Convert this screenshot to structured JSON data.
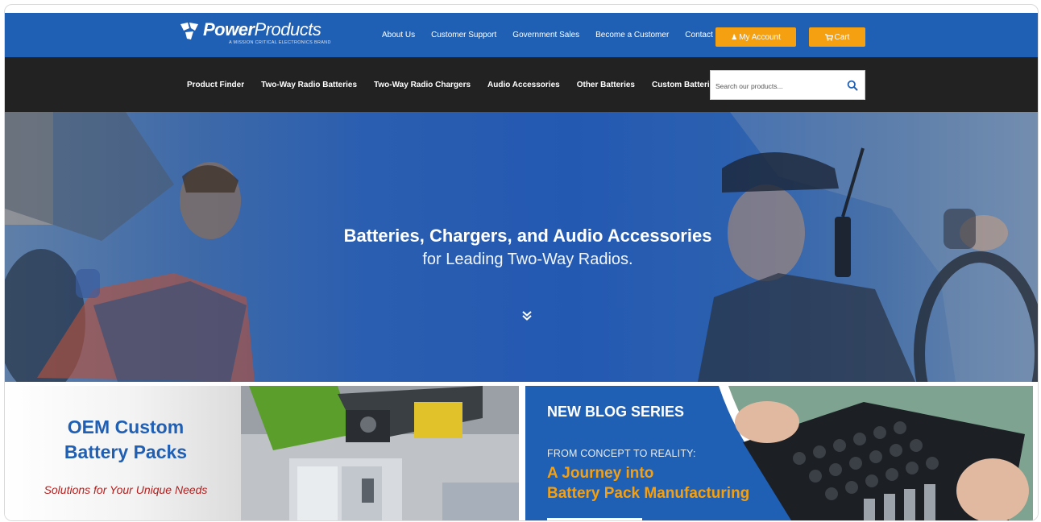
{
  "brand": {
    "name_bold": "Power",
    "name_rest": "Products",
    "tagline": "A Mission Critical Electronics Brand"
  },
  "top_nav": {
    "links": [
      "About Us",
      "Customer Support",
      "Government Sales",
      "Become a Customer",
      "Contact Us"
    ],
    "account_label": "My Account",
    "cart_label": "Cart"
  },
  "main_nav": {
    "items": [
      "Product Finder",
      "Two-Way Radio Batteries",
      "Two-Way Radio Chargers",
      "Audio Accessories",
      "Other Batteries",
      "Custom Batteries"
    ],
    "search_placeholder": "Search our products..."
  },
  "hero": {
    "title": "Batteries, Chargers, and Audio Accessories",
    "subtitle": "for Leading Two-Way Radios."
  },
  "promos": {
    "oem": {
      "title_line1": "OEM Custom",
      "title_line2": "Battery Packs",
      "subtitle": "Solutions for Your Unique Needs"
    },
    "blog": {
      "kicker": "NEW BLOG SERIES",
      "pre": "FROM CONCEPT TO REALITY:",
      "headline_line1": "A Journey into",
      "headline_line2": "Battery Pack Manufacturing"
    }
  },
  "colors": {
    "brand_blue": "#1f5fb4",
    "nav_dark": "#222222",
    "accent_orange": "#f5a011",
    "oem_red": "#b2201f"
  },
  "icons": {
    "account": "user-icon",
    "cart": "cart-icon",
    "search": "search-icon",
    "scroll": "double-chevron-down-icon"
  }
}
